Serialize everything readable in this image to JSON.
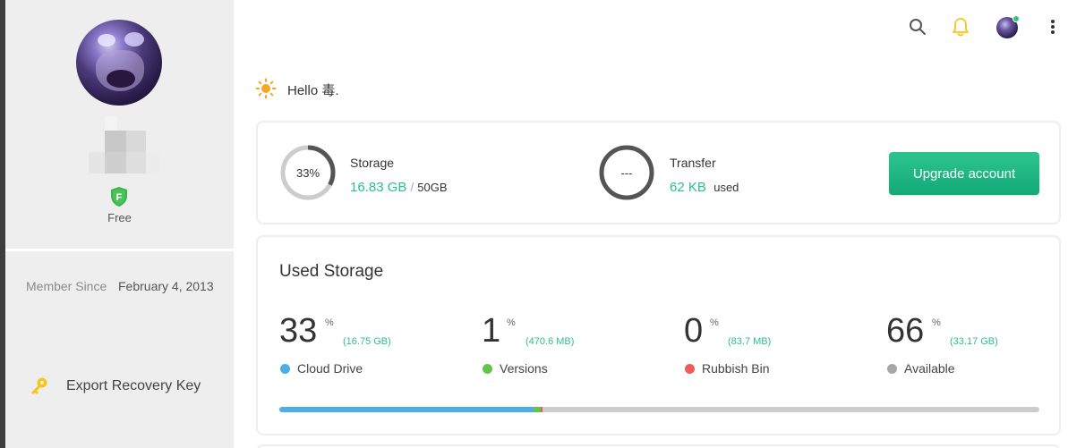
{
  "sidebar": {
    "plan": "Free",
    "member_since_label": "Member Since",
    "member_since_date": "February 4, 2013",
    "export_key_label": "Export Recovery Key"
  },
  "header": {
    "icons": [
      "search-icon",
      "notification-bell-icon",
      "user-avatar",
      "more-vertical-icon"
    ]
  },
  "greeting": "Hello 毒.",
  "storage": {
    "title": "Storage",
    "percent_label": "33%",
    "percent": 33,
    "used": "16.83 GB",
    "separator": "/",
    "total": "50GB"
  },
  "transfer": {
    "title": "Transfer",
    "ring_label": "---",
    "used": "62 KB",
    "used_suffix": "used"
  },
  "upgrade_button": "Upgrade account",
  "used_storage": {
    "title": "Used Storage",
    "metrics": [
      {
        "value": "33",
        "sym": "%",
        "size": "(16.75 GB)",
        "label": "Cloud Drive",
        "color": "#4aaee7"
      },
      {
        "value": "1",
        "sym": "%",
        "size": "(470.6 MB)",
        "label": "Versions",
        "color": "#63c44a"
      },
      {
        "value": "0",
        "sym": "%",
        "size": "(83.7 MB)",
        "label": "Rubbish Bin",
        "color": "#f15a5a"
      },
      {
        "value": "66",
        "sym": "%",
        "size": "(33.17 GB)",
        "label": "Available",
        "color": "#a7a7a7"
      }
    ],
    "bar_fractions": {
      "cloud_drive": 0.335,
      "versions": 0.0094,
      "rubbish_bin": 0.0017
    }
  },
  "colors": {
    "accent_green": "#2bbf8e",
    "bell_yellow": "#f5c518",
    "online_dot": "#32c37a"
  }
}
